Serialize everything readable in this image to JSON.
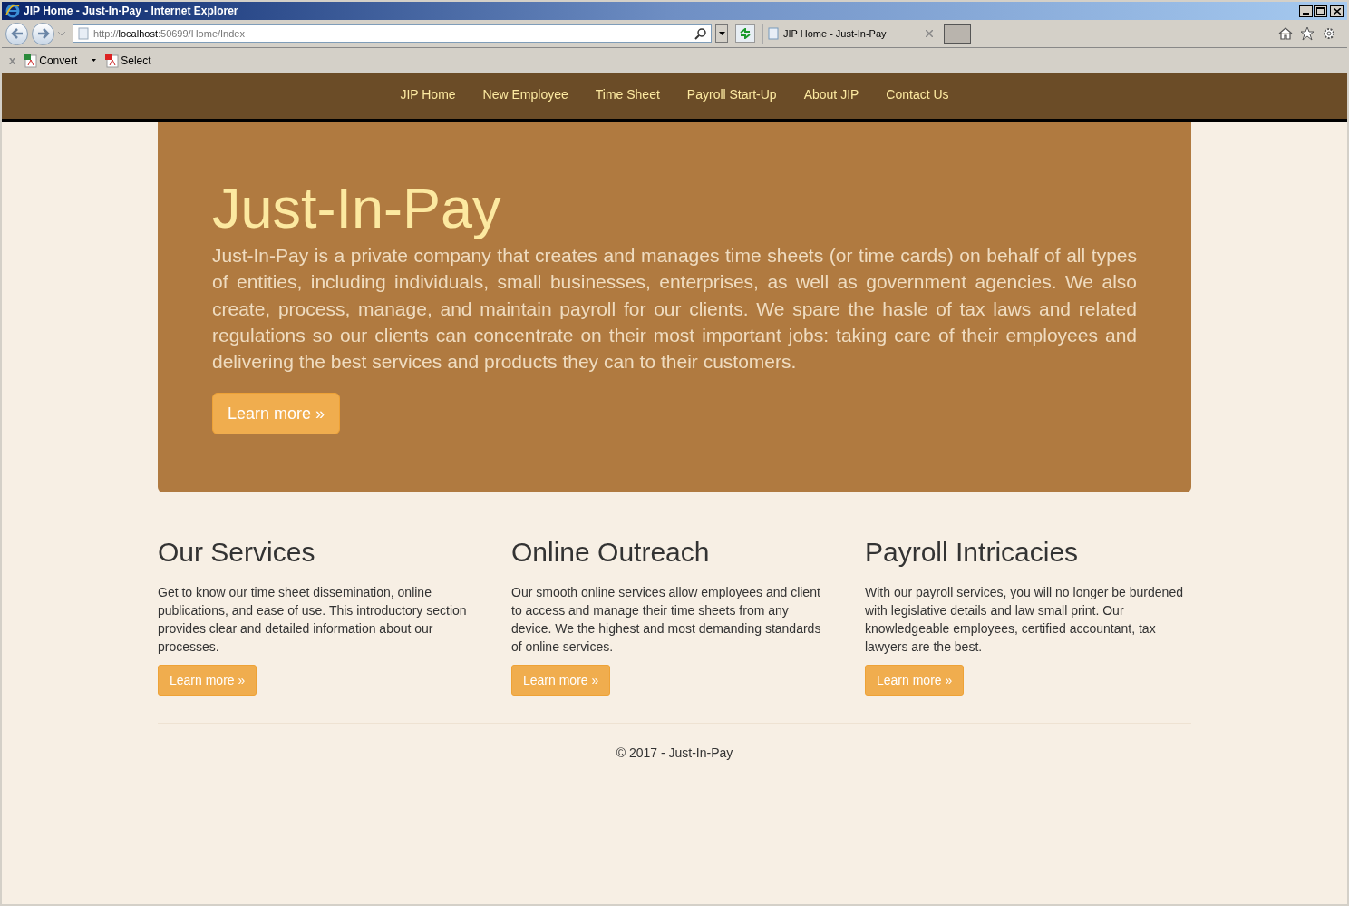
{
  "window": {
    "title": "JIP Home - Just-In-Pay - Internet Explorer"
  },
  "address_bar": {
    "scheme": "http://",
    "host": "localhost",
    "path": ":50699/Home/Index"
  },
  "tabs": [
    {
      "label": "JIP Home - Just-In-Pay",
      "selected": true
    }
  ],
  "command_bar": {
    "close": "x",
    "buttons": [
      {
        "label": "Convert",
        "kind": "dropdown"
      },
      {
        "label": "Select",
        "kind": "plain"
      }
    ]
  },
  "nav": {
    "items": [
      {
        "label": "JIP Home"
      },
      {
        "label": "New Employee"
      },
      {
        "label": "Time Sheet"
      },
      {
        "label": "Payroll Start-Up"
      },
      {
        "label": "About JIP"
      },
      {
        "label": "Contact Us"
      }
    ]
  },
  "hero": {
    "title": "Just-In-Pay",
    "text": "Just-In-Pay is a private company that creates and manages time sheets (or time cards) on behalf of all types of entities, including individuals, small businesses, enterprises, as well as government agencies. We also create, process, manage, and maintain payroll for our clients. We spare the hasle of tax laws and related regulations so our clients can concentrate on their most important jobs: taking care of their employees and delivering the best services and products they can to their customers.",
    "button": "Learn more »"
  },
  "columns": [
    {
      "heading": "Our Services",
      "text": "Get to know our time sheet dissemination, online publications, and ease of use. This introductory section provides clear and detailed information about our processes.",
      "button": "Learn more »"
    },
    {
      "heading": "Online Outreach",
      "text": "Our smooth online services allow employees and client to access and manage their time sheets from any device. We the highest and most demanding standards of online services.",
      "button": "Learn more »"
    },
    {
      "heading": "Payroll Intricacies",
      "text": "With our payroll services, you will no longer be burdened with legislative details and law small print. Our knowledgeable employees, certified accountant, tax lawyers are the best.",
      "button": "Learn more »"
    }
  ],
  "footer": "© 2017 - Just-In-Pay"
}
